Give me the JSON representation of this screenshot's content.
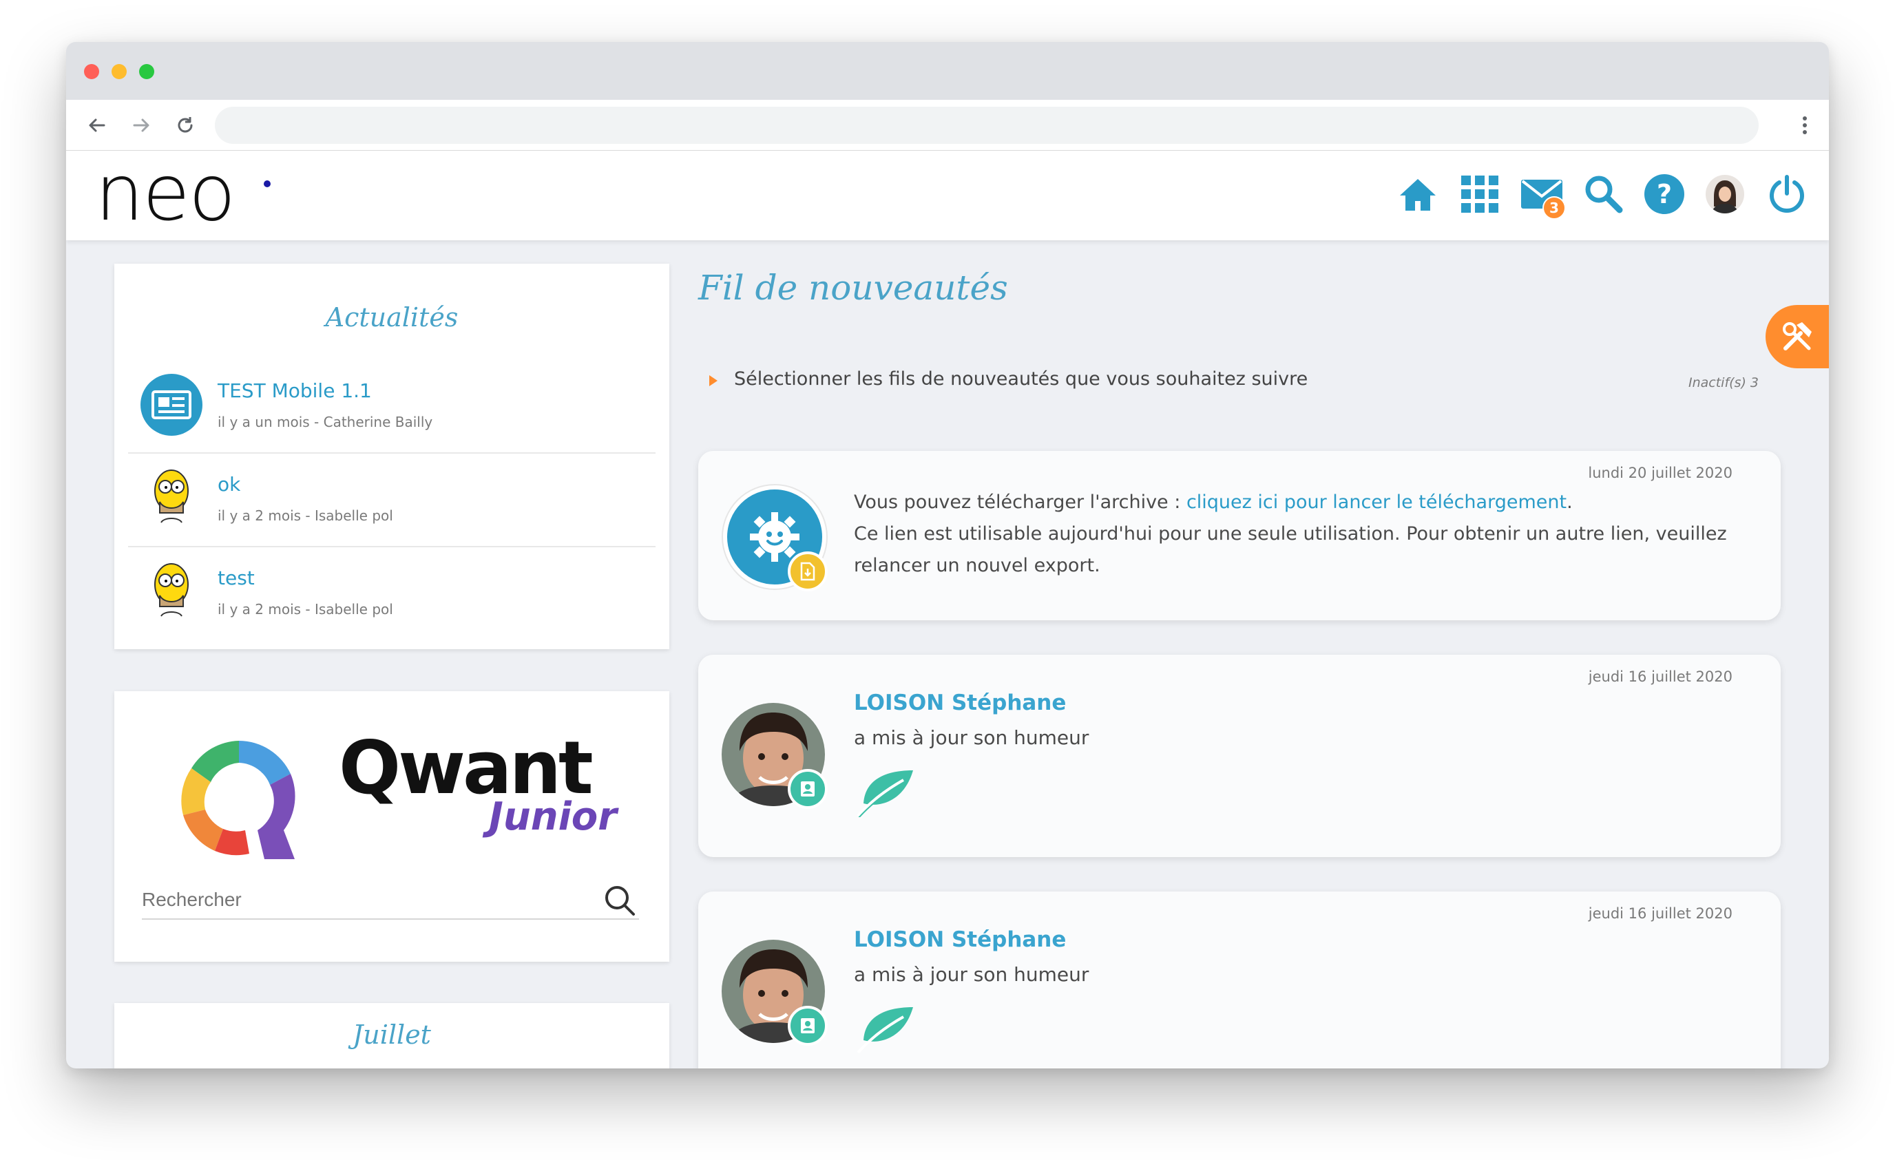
{
  "header": {
    "logo": "neo",
    "mail_count": "3"
  },
  "news": {
    "title": "Actualités",
    "items": [
      {
        "title": "TEST Mobile 1.1",
        "meta": "il y a un mois - Catherine Bailly"
      },
      {
        "title": "ok",
        "meta": "il y a 2 mois - Isabelle pol"
      },
      {
        "title": "test",
        "meta": "il y a 2 mois - Isabelle pol"
      }
    ]
  },
  "qwant": {
    "brand": "Qwant",
    "sub_brand": "Junior",
    "search_placeholder": "Rechercher"
  },
  "calendar": {
    "title": "Juillet"
  },
  "feed": {
    "title": "Fil de nouveautés",
    "filter_label": "Sélectionner les fils de nouveautés que vous souhaitez suivre",
    "inactive_label": "Inactif(s) 3",
    "entries": [
      {
        "date": "lundi 20 juillet 2020",
        "text_prefix": "Vous pouvez télécharger l'archive : ",
        "link": "cliquez ici pour lancer le téléchargement",
        "text_suffix": ".",
        "line2": "Ce lien est utilisable aujourd'hui pour une seule utilisation. Pour obtenir un autre lien, veuillez",
        "line3": "relancer un nouvel export."
      },
      {
        "date": "jeudi 16 juillet 2020",
        "name": "LOISON Stéphane",
        "action": "a mis à jour son humeur"
      },
      {
        "date": "jeudi 16 juillet 2020",
        "name": "LOISON Stéphane",
        "action": "a mis à jour son humeur"
      }
    ]
  },
  "colors": {
    "accent": "#2a9bc8",
    "orange": "#ff8d2e",
    "teal": "#3dbfa6",
    "yellow": "#f2c12e"
  },
  "icons": [
    "back-icon",
    "forward-icon",
    "reload-icon",
    "kebab-icon",
    "home-icon",
    "apps-icon",
    "mail-icon",
    "search-icon",
    "help-icon",
    "power-icon",
    "tools-icon",
    "newspaper-icon",
    "gear-icon",
    "leaf-icon",
    "contact-card-icon",
    "download-file-icon"
  ]
}
